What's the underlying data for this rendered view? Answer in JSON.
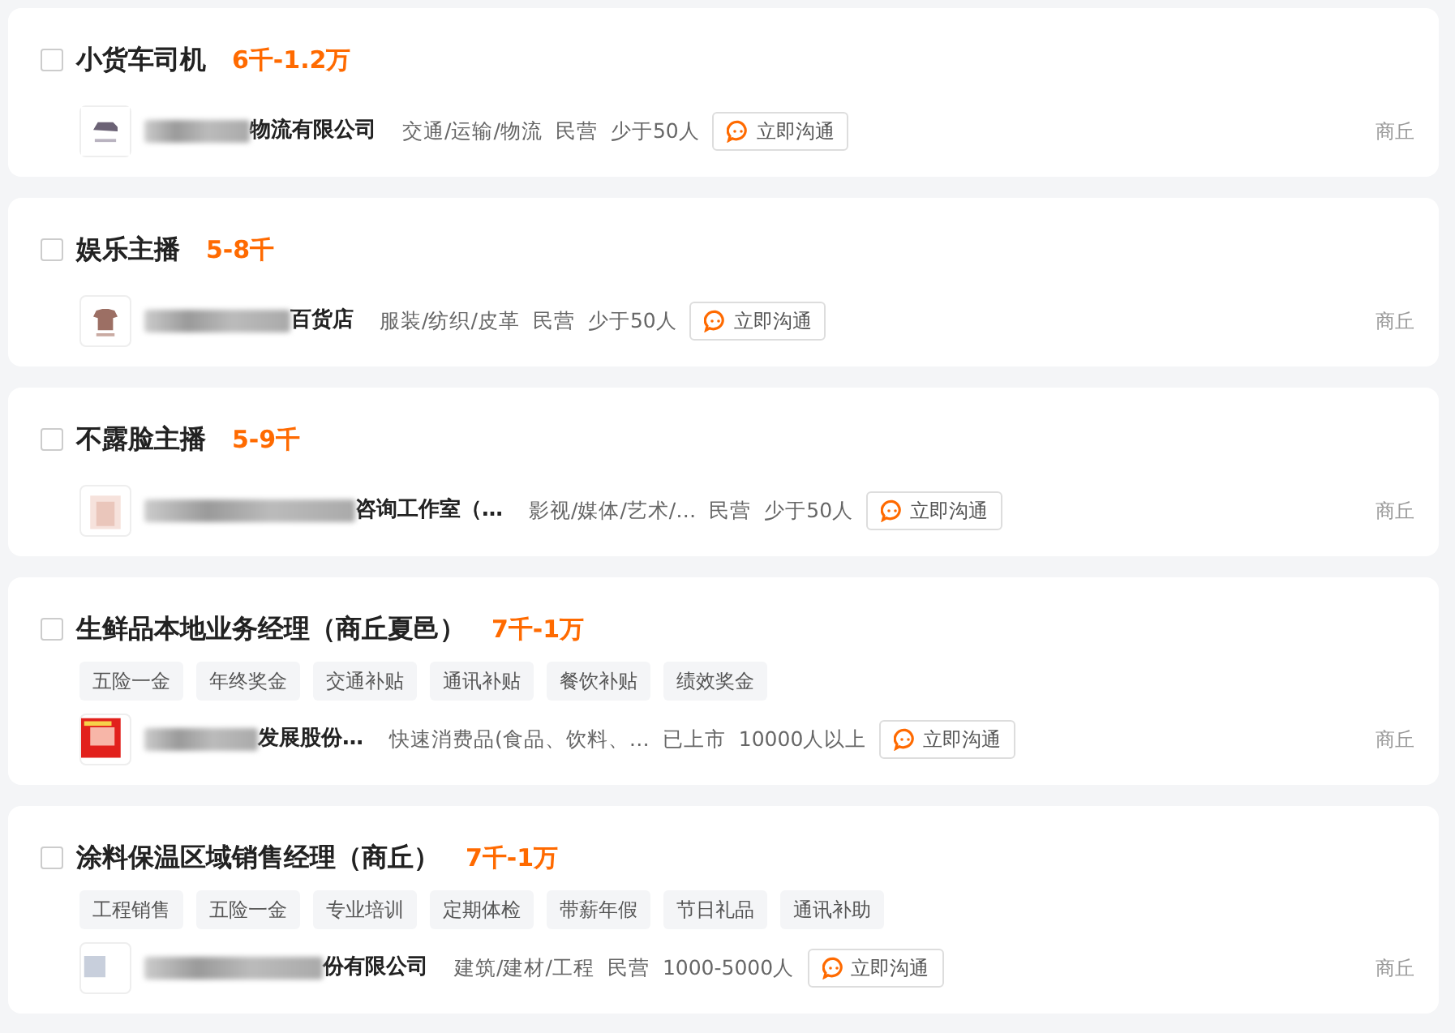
{
  "jobs": [
    {
      "checked": false,
      "title": "小货车司机",
      "salary": "6千-1.2万",
      "company": "物流有限公司",
      "industry": "交通/运输/物流",
      "ownership": "民营",
      "size": "少于50人",
      "chat": "立即沟通",
      "location": "商丘"
    },
    {
      "checked": false,
      "title": "娱乐主播",
      "salary": "5-8千",
      "company": "百货店",
      "industry": "服装/纺织/皮革",
      "ownership": "民营",
      "size": "少于50人",
      "chat": "立即沟通",
      "location": "商丘"
    },
    {
      "checked": false,
      "title": "不露脸主播",
      "salary": "5-9千",
      "company": "咨询工作室（…",
      "industry": "影视/媒体/艺术/…",
      "ownership": "民营",
      "size": "少于50人",
      "chat": "立即沟通",
      "location": "商丘"
    },
    {
      "checked": false,
      "title": "生鲜品本地业务经理（商丘夏邑）",
      "salary": "7千-1万",
      "welfare": [
        "五险一金",
        "年终奖金",
        "交通补贴",
        "通讯补贴",
        "餐饮补贴",
        "绩效奖金"
      ],
      "company": "发展股份…",
      "industry": "快速消费品(食品、饮料、…",
      "ownership": "已上市",
      "size": "10000人以上",
      "chat": "立即沟通",
      "location": "商丘"
    },
    {
      "checked": false,
      "title": "涂料保温区域销售经理（商丘）",
      "salary": "7千-1万",
      "welfare": [
        "工程销售",
        "五险一金",
        "专业培训",
        "定期体检",
        "带薪年假",
        "节日礼品",
        "通讯补助"
      ],
      "company": "份有限公司",
      "industry": "建筑/建材/工程",
      "ownership": "民营",
      "size": "1000-5000人",
      "chat": "立即沟通",
      "location": "商丘"
    }
  ]
}
